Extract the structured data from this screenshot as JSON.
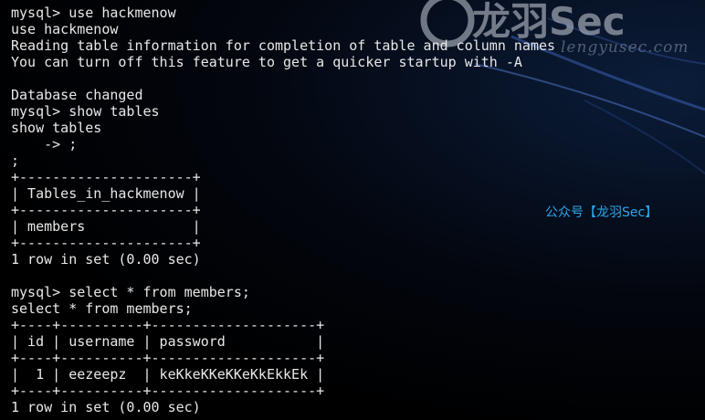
{
  "terminal": {
    "lines": [
      "mysql> use hackmenow",
      "use hackmenow",
      "Reading table information for completion of table and column names",
      "You can turn off this feature to get a quicker startup with -A",
      "",
      "Database changed",
      "mysql> show tables",
      "show tables",
      "    -> ;",
      ";",
      "+---------------------+",
      "| Tables_in_hackmenow |",
      "+---------------------+",
      "| members             |",
      "+---------------------+",
      "1 row in set (0.00 sec)",
      "",
      "mysql> select * from members;",
      "select * from members;",
      "+----+----------+--------------------+",
      "| id | username | password           |",
      "+----+----------+--------------------+",
      "|  1 | eezeepz  | keKkeKKeKKeKkEkkEk |",
      "+----+----------+--------------------+",
      "1 row in set (0.00 sec)"
    ]
  },
  "watermark": {
    "logo_text": "龙羽Sec",
    "url": "lengyusec.com",
    "wechat": "公众号【龙羽Sec】"
  },
  "colors": {
    "terminal_text": "#e8e8e8",
    "wechat_accent": "#2aa7e8",
    "background": "#000000"
  }
}
